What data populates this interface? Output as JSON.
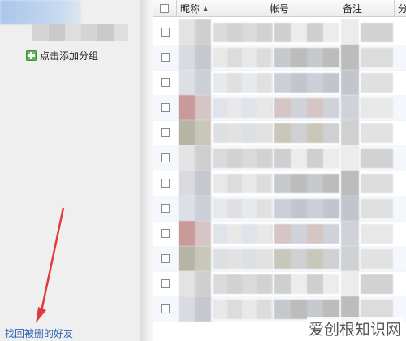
{
  "left_panel": {
    "add_group_label": "点击添加分组",
    "find_deleted_friends_label": "找回被删的好友"
  },
  "table": {
    "columns": {
      "nickname": "昵称",
      "account": "帐号",
      "note": "备注",
      "group": "分"
    },
    "sort_indicator": "▲",
    "row_count": 12
  },
  "watermark": "爱创根知识网",
  "colors": {
    "link": "#2d64b3",
    "arrow": "#e23b3b",
    "plus": "#5cb85c",
    "row_alt": "#f4f8fd"
  }
}
